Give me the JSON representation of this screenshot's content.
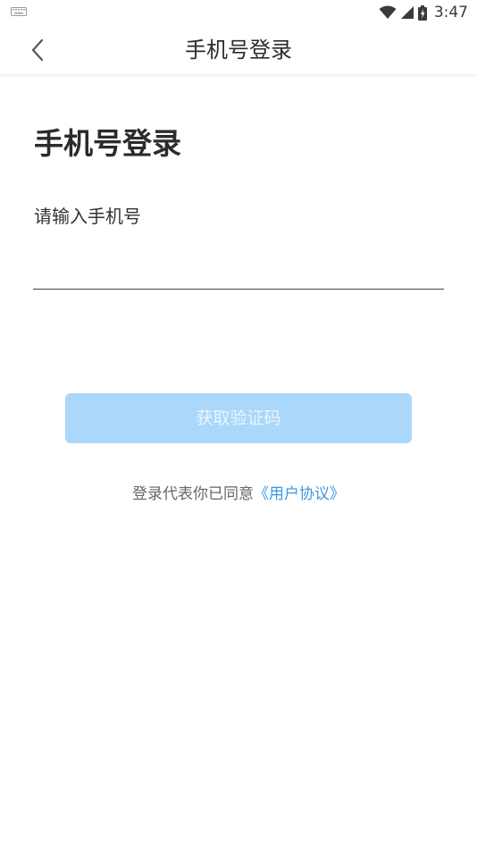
{
  "status_bar": {
    "time": "3:47",
    "icons": [
      "keyboard-icon",
      "wifi-icon",
      "signal-icon",
      "battery-icon"
    ]
  },
  "header": {
    "title": "手机号登录",
    "back_icon": "chevron-left-icon"
  },
  "main": {
    "heading": "手机号登录",
    "phone_label": "请输入手机号",
    "phone_value": "",
    "get_code_label": "获取验证码",
    "agreement_text": "登录代表你已同意",
    "agreement_link": "《用户协议》"
  },
  "colors": {
    "button_bg": "#aad7fa",
    "button_text": "#eaf5fe",
    "link": "#3b97e3",
    "text_primary": "#2b2b2b",
    "text_secondary": "#666666"
  }
}
